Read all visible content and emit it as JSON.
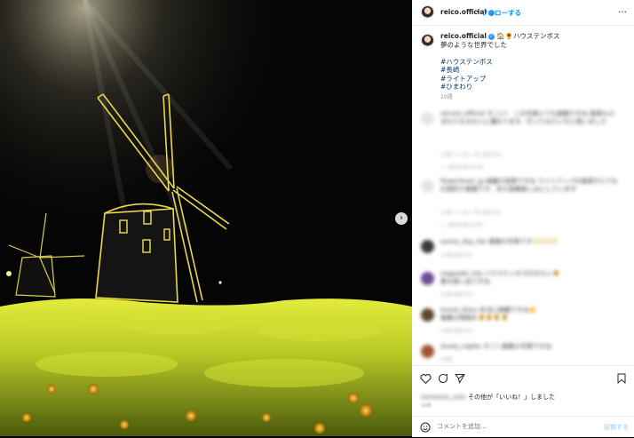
{
  "post": {
    "username": "reico.official",
    "follow_label": "フォローする",
    "dot": "•",
    "more_label": "…",
    "caption_text": "🏠🌻ハウステンボス",
    "caption_line2": "夢のような世界でした",
    "hashtags": [
      "#ハウステンボス",
      "#長崎",
      "#ライトアップ",
      "#ひまわり"
    ],
    "caption_time": "10週"
  },
  "comments": [
    {
      "text": "reiconi_official すごい！ この写真とても素敵ですね 風車もひまわりもきれいに撮れてます、行ってみたいなと思いました",
      "meta": "10週  いいね！1件  返信する",
      "replies": "── 返信を表示(1件)",
      "color": "#e6e6e6"
    },
    {
      "text": "flowerlover_jp 綺麗な夜景ですね ライトアップの風車がとても幻想的で素敵です、また投稿楽しみにしています",
      "meta": "10週  いいね！2件  返信する",
      "replies": "── 返信を表示(2件)",
      "color": "#e6e6e6"
    },
    {
      "text": "sunny_day_fan 素敵な写真です",
      "emoji": "😍😍😍😍",
      "meta": "10週  返信する",
      "color": "#3a3a3a"
    },
    {
      "text": "nagasaki_trip ハウステンボス行きたい",
      "emoji": "🌻",
      "text2": "夏の思い出ですね",
      "meta": "10週  返信する",
      "color": "#6a4c93"
    },
    {
      "text": "travel_diary 本当に綺麗ですね",
      "emoji": "👏",
      "text2": "素敵な時間を",
      "emoji2": "🌻🌻🌻🌻",
      "meta": "10週  返信する",
      "color": "#5a4630"
    },
    {
      "text": "lovely_nights すごく素敵な写真ですね",
      "meta": "10週",
      "color": "#a0522d"
    }
  ],
  "likes": {
    "liker_blurred": "someone_user",
    "text": "その他が「いいね！」しました",
    "date": "10週"
  },
  "add_comment": {
    "placeholder": "コメントを追加...",
    "post_label": "投稿する"
  },
  "icons": {
    "heart": "heart-icon",
    "comment": "comment-icon",
    "share": "share-icon",
    "bookmark": "bookmark-icon",
    "emoji": "smile-icon",
    "next": "chevron-right-icon"
  },
  "colors": {
    "accent": "#0095f6",
    "hashtag": "#00376b",
    "verified": "#3897f0"
  }
}
